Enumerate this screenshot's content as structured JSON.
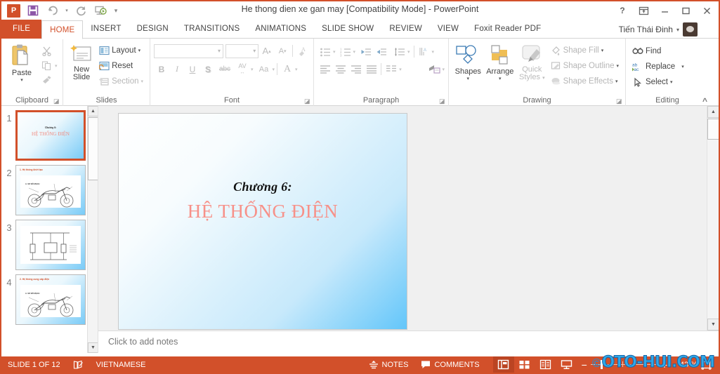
{
  "window": {
    "title": "He thong dien xe gan may [Compatibility Mode] - PowerPoint",
    "app_logo": "P",
    "controls": {
      "help": "?",
      "ribbon_display": "ribbon-display-options-icon",
      "minimize": "—",
      "maximize": "▢",
      "close": "✕"
    }
  },
  "quick_access": {
    "save": "save-icon",
    "undo": "undo-icon",
    "undo_caret": "▾",
    "redo": "redo-icon",
    "slideshow": "start-slideshow-icon",
    "customize": "▾"
  },
  "account": {
    "name": "Tiến Thái Đinh",
    "caret": "▾"
  },
  "ribbon": {
    "tabs": [
      {
        "label": "FILE",
        "type": "file"
      },
      {
        "label": "HOME",
        "type": "active"
      },
      {
        "label": "INSERT",
        "type": "normal"
      },
      {
        "label": "DESIGN",
        "type": "normal"
      },
      {
        "label": "TRANSITIONS",
        "type": "normal"
      },
      {
        "label": "ANIMATIONS",
        "type": "normal"
      },
      {
        "label": "SLIDE SHOW",
        "type": "normal"
      },
      {
        "label": "REVIEW",
        "type": "normal"
      },
      {
        "label": "VIEW",
        "type": "normal"
      },
      {
        "label": "Foxit Reader PDF",
        "type": "normal"
      }
    ],
    "groups": {
      "clipboard": {
        "label": "Clipboard",
        "paste": "Paste",
        "paste_caret": "▾",
        "cut": "cut-icon",
        "copy": "copy-icon",
        "copy_caret": "▾",
        "format_painter": "format-painter-icon",
        "dialog_launcher": "◪"
      },
      "slides": {
        "label": "Slides",
        "new_slide": "New",
        "new_slide2": "Slide",
        "new_slide_caret": "▾",
        "layout": "Layout",
        "layout_caret": "▾",
        "reset": "Reset",
        "section": "Section",
        "section_caret": "▾"
      },
      "font": {
        "label": "Font",
        "font_name_value": "",
        "font_size_value": "",
        "grow_font": "A",
        "shrink_font": "A",
        "clear_formatting": "clear-formatting-icon",
        "bold": "B",
        "italic": "I",
        "underline": "U",
        "shadow": "S",
        "strikethrough": "abc",
        "character_spacing": "AV",
        "change_case": "Aa",
        "font_color": "A",
        "dialog_launcher": "◪"
      },
      "paragraph": {
        "label": "Paragraph",
        "bullets": "bullets-icon",
        "numbering": "numbering-icon",
        "decrease_indent": "decrease-indent-icon",
        "increase_indent": "increase-indent-icon",
        "line_spacing": "line-spacing-icon",
        "text_direction": "text-direction-icon",
        "align_text": "align-text-icon",
        "convert_smartart": "convert-to-smartart-icon",
        "align_left": "align-left-icon",
        "center": "align-center-icon",
        "align_right": "align-right-icon",
        "justify": "justify-icon",
        "columns": "columns-icon",
        "dialog_launcher": "◪"
      },
      "drawing": {
        "label": "Drawing",
        "shapes": "Shapes",
        "shapes_caret": "▾",
        "arrange": "Arrange",
        "arrange_caret": "▾",
        "quick_styles": "Quick",
        "quick_styles2": "Styles",
        "quick_styles_caret": "▾",
        "shape_fill": "Shape Fill",
        "shape_fill_caret": "▾",
        "shape_outline": "Shape Outline",
        "shape_outline_caret": "▾",
        "shape_effects": "Shape Effects",
        "shape_effects_caret": "▾",
        "dialog_launcher": "◪"
      },
      "editing": {
        "label": "Editing",
        "find": "Find",
        "replace": "Replace",
        "replace_caret": "▾",
        "select": "Select",
        "select_caret": "▾",
        "collapse_ribbon": "^"
      }
    }
  },
  "thumbnails": [
    {
      "number": "1",
      "selected": true,
      "kind": "title",
      "line1": "Chương 6:",
      "line2": "HỆ THỐNG ĐIỆN"
    },
    {
      "number": "2",
      "selected": false,
      "kind": "moto",
      "heading": "1. Hệ thống khởi tạo",
      "sub": "A. SƠ ĐỒ MẠCH"
    },
    {
      "number": "3",
      "selected": false,
      "kind": "circuit",
      "heading": "",
      "sub": ""
    },
    {
      "number": "4",
      "selected": false,
      "kind": "moto",
      "heading": "2. Hệ thống cung cấp điện",
      "sub": "A. SƠ ĐỒ MẠCH"
    }
  ],
  "thumb_scroll": {
    "up": "▲",
    "down": "▼"
  },
  "slide": {
    "line1": "Chương 6:",
    "line2": "HỆ THỐNG ĐIỆN"
  },
  "editor_scroll": {
    "up": "▲",
    "down": "▼",
    "previous_slide": "▲",
    "next_slide": "▼"
  },
  "notes": {
    "placeholder": "Click to add notes"
  },
  "status_bar": {
    "slide_counter": "SLIDE 1 OF 12",
    "spelling_icon": "spell-check-icon",
    "language": "VIETNAMESE",
    "notes_label": "NOTES",
    "notes_icon": "notes-icon",
    "comments_label": "COMMENTS",
    "comments_icon": "comment-icon",
    "views": [
      {
        "name": "normal-view",
        "icon": "normal-view-icon",
        "active": true
      },
      {
        "name": "slide-sorter-view",
        "icon": "slide-sorter-icon",
        "active": false
      },
      {
        "name": "reading-view",
        "icon": "reading-view-icon",
        "active": false
      },
      {
        "name": "slide-show-view",
        "icon": "slide-show-icon",
        "active": false
      }
    ],
    "zoom_out": "−",
    "zoom_in": "+",
    "zoom_value": "43 %",
    "fit_to_window": "fit-slide-icon"
  },
  "watermark": {
    "copyright": "©",
    "text": "OTO-HUI.COM"
  },
  "colors": {
    "accent": "#D2502A",
    "title_pink": "#F79189",
    "slide_blue": "#63C6FA",
    "watermark_blue": "#2FA8E8"
  }
}
